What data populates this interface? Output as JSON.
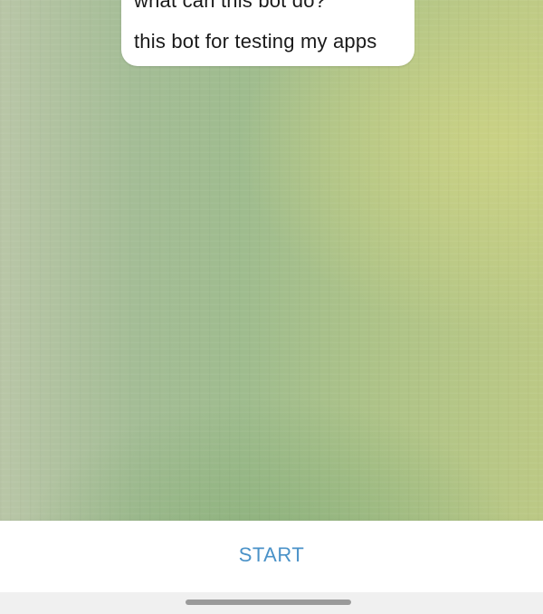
{
  "chat": {
    "message": {
      "partial_line": "what can this bot do?",
      "text": "this bot for testing my apps"
    }
  },
  "bottom_bar": {
    "start_label": "START",
    "accent_color": "#4a92c8"
  },
  "colors": {
    "wallpaper_left": "#b9c6a7",
    "wallpaper_mid": "#9fbc8e",
    "wallpaper_right": "#bcc985",
    "bubble_background": "#ffffff",
    "text": "#1a1a1a"
  }
}
